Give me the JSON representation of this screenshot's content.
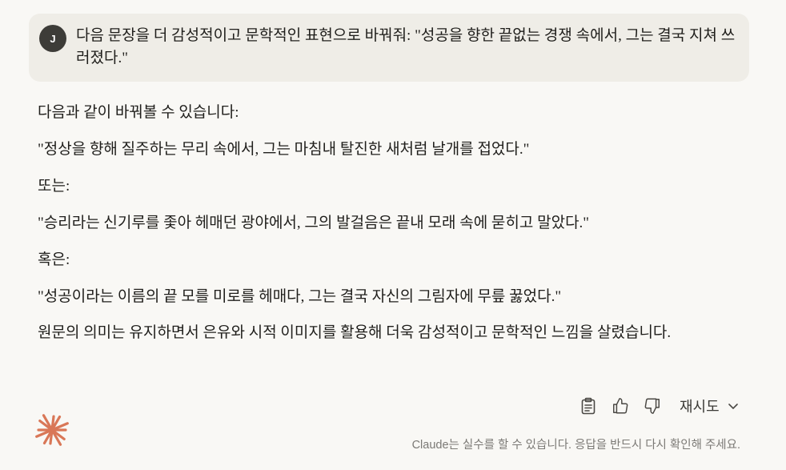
{
  "user_message": {
    "avatar_initial": "J",
    "text": "다음 문장을 더 감성적이고 문학적인 표현으로 바꿔줘: \"성공을 향한 끝없는 경쟁 속에서, 그는 결국 지쳐 쓰러졌다.\""
  },
  "assistant_reply": {
    "intro": "다음과 같이 바꿔볼 수 있습니다:",
    "option1": "\"정상을 향해 질주하는 무리 속에서, 그는 마침내 탈진한 새처럼 날개를 접었다.\"",
    "label_or": "또는:",
    "option2": "\"승리라는 신기루를 좇아 헤매던 광야에서, 그의 발걸음은 끝내 모래 속에 묻히고 말았다.\"",
    "label_or2": "혹은:",
    "option3": "\"성공이라는 이름의 끝 모를 미로를 헤매다, 그는 결국 자신의 그림자에 무릎 꿇었다.\"",
    "closing": "원문의 의미는 유지하면서 은유와 시적 이미지를 활용해 더욱 감성적이고 문학적인 느낌을 살렸습니다."
  },
  "actions": {
    "copy_icon": "clipboard-icon",
    "like_icon": "thumbs-up-icon",
    "dislike_icon": "thumbs-down-icon",
    "retry_label": "재시도"
  },
  "footer": {
    "logo": "claude-sparkle-logo",
    "disclaimer": "Claude는 실수를 할 수 있습니다. 응답을 반드시 다시 확인해 주세요."
  },
  "colors": {
    "background": "#f9f8f5",
    "user_bubble": "#efede7",
    "avatar": "#3d3c38",
    "logo": "#d97757"
  }
}
